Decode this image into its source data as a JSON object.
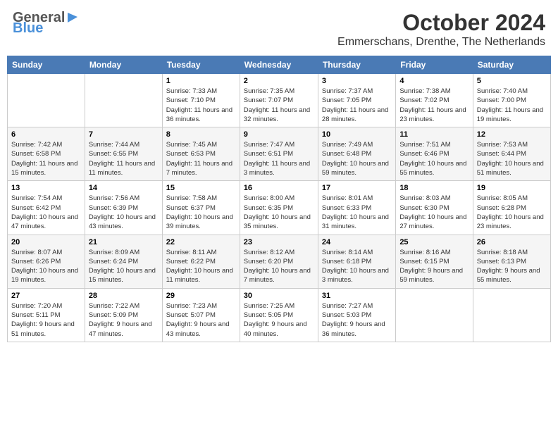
{
  "header": {
    "logo_general": "General",
    "logo_blue": "Blue",
    "month_title": "October 2024",
    "subtitle": "Emmerschans, Drenthe, The Netherlands"
  },
  "days_of_week": [
    "Sunday",
    "Monday",
    "Tuesday",
    "Wednesday",
    "Thursday",
    "Friday",
    "Saturday"
  ],
  "weeks": [
    [
      {
        "day": "",
        "info": ""
      },
      {
        "day": "",
        "info": ""
      },
      {
        "day": "1",
        "sunrise": "Sunrise: 7:33 AM",
        "sunset": "Sunset: 7:10 PM",
        "daylight": "Daylight: 11 hours and 36 minutes."
      },
      {
        "day": "2",
        "sunrise": "Sunrise: 7:35 AM",
        "sunset": "Sunset: 7:07 PM",
        "daylight": "Daylight: 11 hours and 32 minutes."
      },
      {
        "day": "3",
        "sunrise": "Sunrise: 7:37 AM",
        "sunset": "Sunset: 7:05 PM",
        "daylight": "Daylight: 11 hours and 28 minutes."
      },
      {
        "day": "4",
        "sunrise": "Sunrise: 7:38 AM",
        "sunset": "Sunset: 7:02 PM",
        "daylight": "Daylight: 11 hours and 23 minutes."
      },
      {
        "day": "5",
        "sunrise": "Sunrise: 7:40 AM",
        "sunset": "Sunset: 7:00 PM",
        "daylight": "Daylight: 11 hours and 19 minutes."
      }
    ],
    [
      {
        "day": "6",
        "sunrise": "Sunrise: 7:42 AM",
        "sunset": "Sunset: 6:58 PM",
        "daylight": "Daylight: 11 hours and 15 minutes."
      },
      {
        "day": "7",
        "sunrise": "Sunrise: 7:44 AM",
        "sunset": "Sunset: 6:55 PM",
        "daylight": "Daylight: 11 hours and 11 minutes."
      },
      {
        "day": "8",
        "sunrise": "Sunrise: 7:45 AM",
        "sunset": "Sunset: 6:53 PM",
        "daylight": "Daylight: 11 hours and 7 minutes."
      },
      {
        "day": "9",
        "sunrise": "Sunrise: 7:47 AM",
        "sunset": "Sunset: 6:51 PM",
        "daylight": "Daylight: 11 hours and 3 minutes."
      },
      {
        "day": "10",
        "sunrise": "Sunrise: 7:49 AM",
        "sunset": "Sunset: 6:48 PM",
        "daylight": "Daylight: 10 hours and 59 minutes."
      },
      {
        "day": "11",
        "sunrise": "Sunrise: 7:51 AM",
        "sunset": "Sunset: 6:46 PM",
        "daylight": "Daylight: 10 hours and 55 minutes."
      },
      {
        "day": "12",
        "sunrise": "Sunrise: 7:53 AM",
        "sunset": "Sunset: 6:44 PM",
        "daylight": "Daylight: 10 hours and 51 minutes."
      }
    ],
    [
      {
        "day": "13",
        "sunrise": "Sunrise: 7:54 AM",
        "sunset": "Sunset: 6:42 PM",
        "daylight": "Daylight: 10 hours and 47 minutes."
      },
      {
        "day": "14",
        "sunrise": "Sunrise: 7:56 AM",
        "sunset": "Sunset: 6:39 PM",
        "daylight": "Daylight: 10 hours and 43 minutes."
      },
      {
        "day": "15",
        "sunrise": "Sunrise: 7:58 AM",
        "sunset": "Sunset: 6:37 PM",
        "daylight": "Daylight: 10 hours and 39 minutes."
      },
      {
        "day": "16",
        "sunrise": "Sunrise: 8:00 AM",
        "sunset": "Sunset: 6:35 PM",
        "daylight": "Daylight: 10 hours and 35 minutes."
      },
      {
        "day": "17",
        "sunrise": "Sunrise: 8:01 AM",
        "sunset": "Sunset: 6:33 PM",
        "daylight": "Daylight: 10 hours and 31 minutes."
      },
      {
        "day": "18",
        "sunrise": "Sunrise: 8:03 AM",
        "sunset": "Sunset: 6:30 PM",
        "daylight": "Daylight: 10 hours and 27 minutes."
      },
      {
        "day": "19",
        "sunrise": "Sunrise: 8:05 AM",
        "sunset": "Sunset: 6:28 PM",
        "daylight": "Daylight: 10 hours and 23 minutes."
      }
    ],
    [
      {
        "day": "20",
        "sunrise": "Sunrise: 8:07 AM",
        "sunset": "Sunset: 6:26 PM",
        "daylight": "Daylight: 10 hours and 19 minutes."
      },
      {
        "day": "21",
        "sunrise": "Sunrise: 8:09 AM",
        "sunset": "Sunset: 6:24 PM",
        "daylight": "Daylight: 10 hours and 15 minutes."
      },
      {
        "day": "22",
        "sunrise": "Sunrise: 8:11 AM",
        "sunset": "Sunset: 6:22 PM",
        "daylight": "Daylight: 10 hours and 11 minutes."
      },
      {
        "day": "23",
        "sunrise": "Sunrise: 8:12 AM",
        "sunset": "Sunset: 6:20 PM",
        "daylight": "Daylight: 10 hours and 7 minutes."
      },
      {
        "day": "24",
        "sunrise": "Sunrise: 8:14 AM",
        "sunset": "Sunset: 6:18 PM",
        "daylight": "Daylight: 10 hours and 3 minutes."
      },
      {
        "day": "25",
        "sunrise": "Sunrise: 8:16 AM",
        "sunset": "Sunset: 6:15 PM",
        "daylight": "Daylight: 9 hours and 59 minutes."
      },
      {
        "day": "26",
        "sunrise": "Sunrise: 8:18 AM",
        "sunset": "Sunset: 6:13 PM",
        "daylight": "Daylight: 9 hours and 55 minutes."
      }
    ],
    [
      {
        "day": "27",
        "sunrise": "Sunrise: 7:20 AM",
        "sunset": "Sunset: 5:11 PM",
        "daylight": "Daylight: 9 hours and 51 minutes."
      },
      {
        "day": "28",
        "sunrise": "Sunrise: 7:22 AM",
        "sunset": "Sunset: 5:09 PM",
        "daylight": "Daylight: 9 hours and 47 minutes."
      },
      {
        "day": "29",
        "sunrise": "Sunrise: 7:23 AM",
        "sunset": "Sunset: 5:07 PM",
        "daylight": "Daylight: 9 hours and 43 minutes."
      },
      {
        "day": "30",
        "sunrise": "Sunrise: 7:25 AM",
        "sunset": "Sunset: 5:05 PM",
        "daylight": "Daylight: 9 hours and 40 minutes."
      },
      {
        "day": "31",
        "sunrise": "Sunrise: 7:27 AM",
        "sunset": "Sunset: 5:03 PM",
        "daylight": "Daylight: 9 hours and 36 minutes."
      },
      {
        "day": "",
        "info": ""
      },
      {
        "day": "",
        "info": ""
      }
    ]
  ]
}
